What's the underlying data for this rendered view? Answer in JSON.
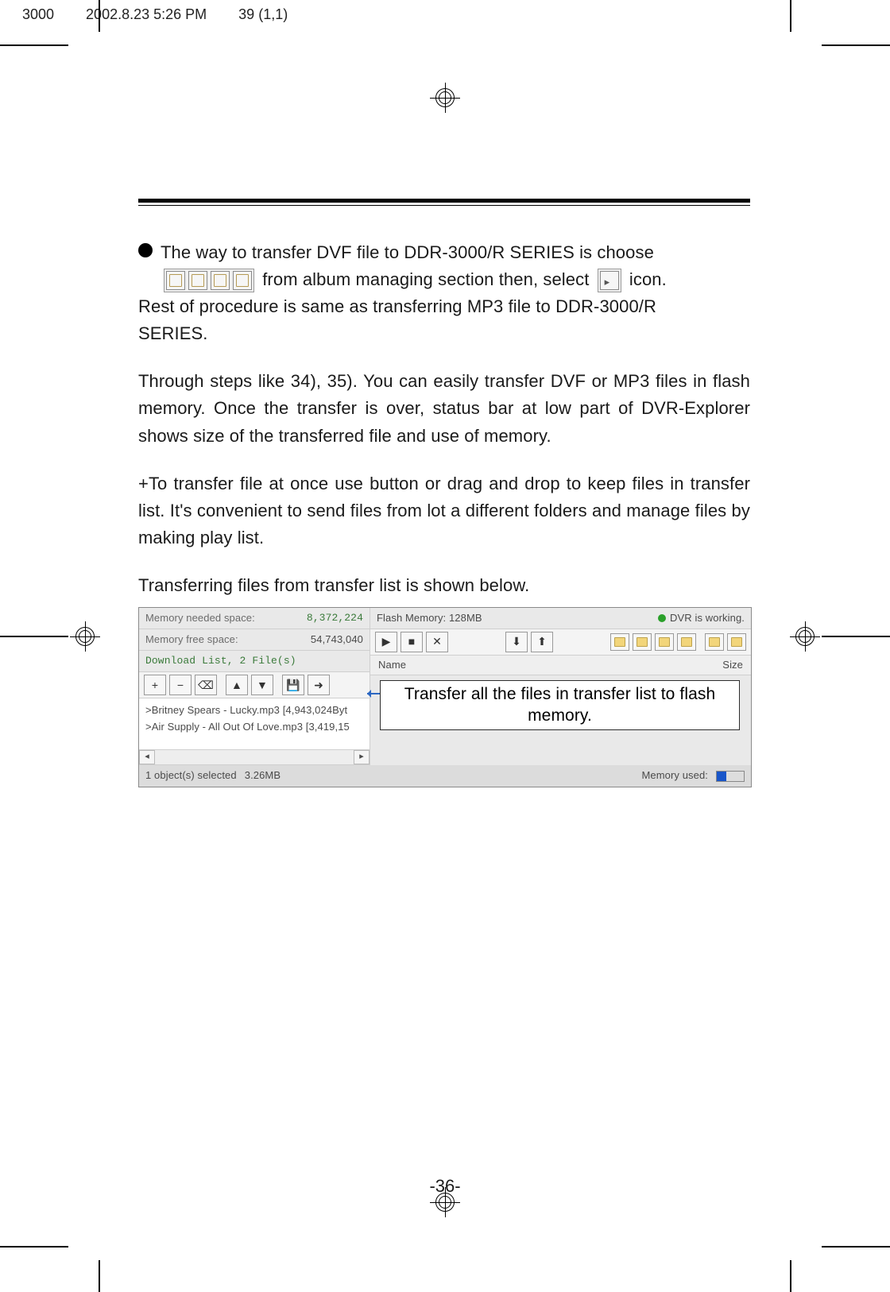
{
  "header": {
    "left1": "3000",
    "left2": "2002.8.23 5:26 PM",
    "left3": "39 (1,1)"
  },
  "body": {
    "bullet1_line1": "The way to transfer DVF file to DDR-3000/R SERIES is choose",
    "bullet1_line2a": "from album managing section then, select",
    "bullet1_line2b": "icon.",
    "bullet1_line3": "Rest of procedure is same as transferring MP3 file to DDR-3000/R",
    "bullet1_line4": "SERIES.",
    "para2": "Through steps like 34), 35). You can easily transfer DVF or MP3 files in flash memory. Once the transfer is over, status bar at low part of DVR-Explorer shows size of the transferred file and use of memory.",
    "para3": "+To transfer file at once use button or drag and drop to keep files in transfer list. It's convenient to send files from lot a different folders and manage files by making play list.",
    "para4": "Transferring files from transfer list is shown below."
  },
  "shot": {
    "mem_needed_label": "Memory needed space:",
    "mem_needed_val": "8,372,224",
    "mem_free_label": "Memory free space:",
    "mem_free_val": "54,743,040",
    "download_list": "Download List, 2 File(s)",
    "flash_label": "Flash Memory: 128MB",
    "dvr_state": "DVR is working.",
    "name_col": "Name",
    "size_col": "Size",
    "file1": ">Britney Spears - Lucky.mp3  [4,943,024Byt",
    "file2": ">Air Supply - All Out Of Love.mp3  [3,419,15",
    "status_left": "1 object(s) selected",
    "status_size": "3.26MB",
    "status_right": "Memory used:"
  },
  "callout": "Transfer all the files in transfer list to flash memory.",
  "page_number": "-36-"
}
